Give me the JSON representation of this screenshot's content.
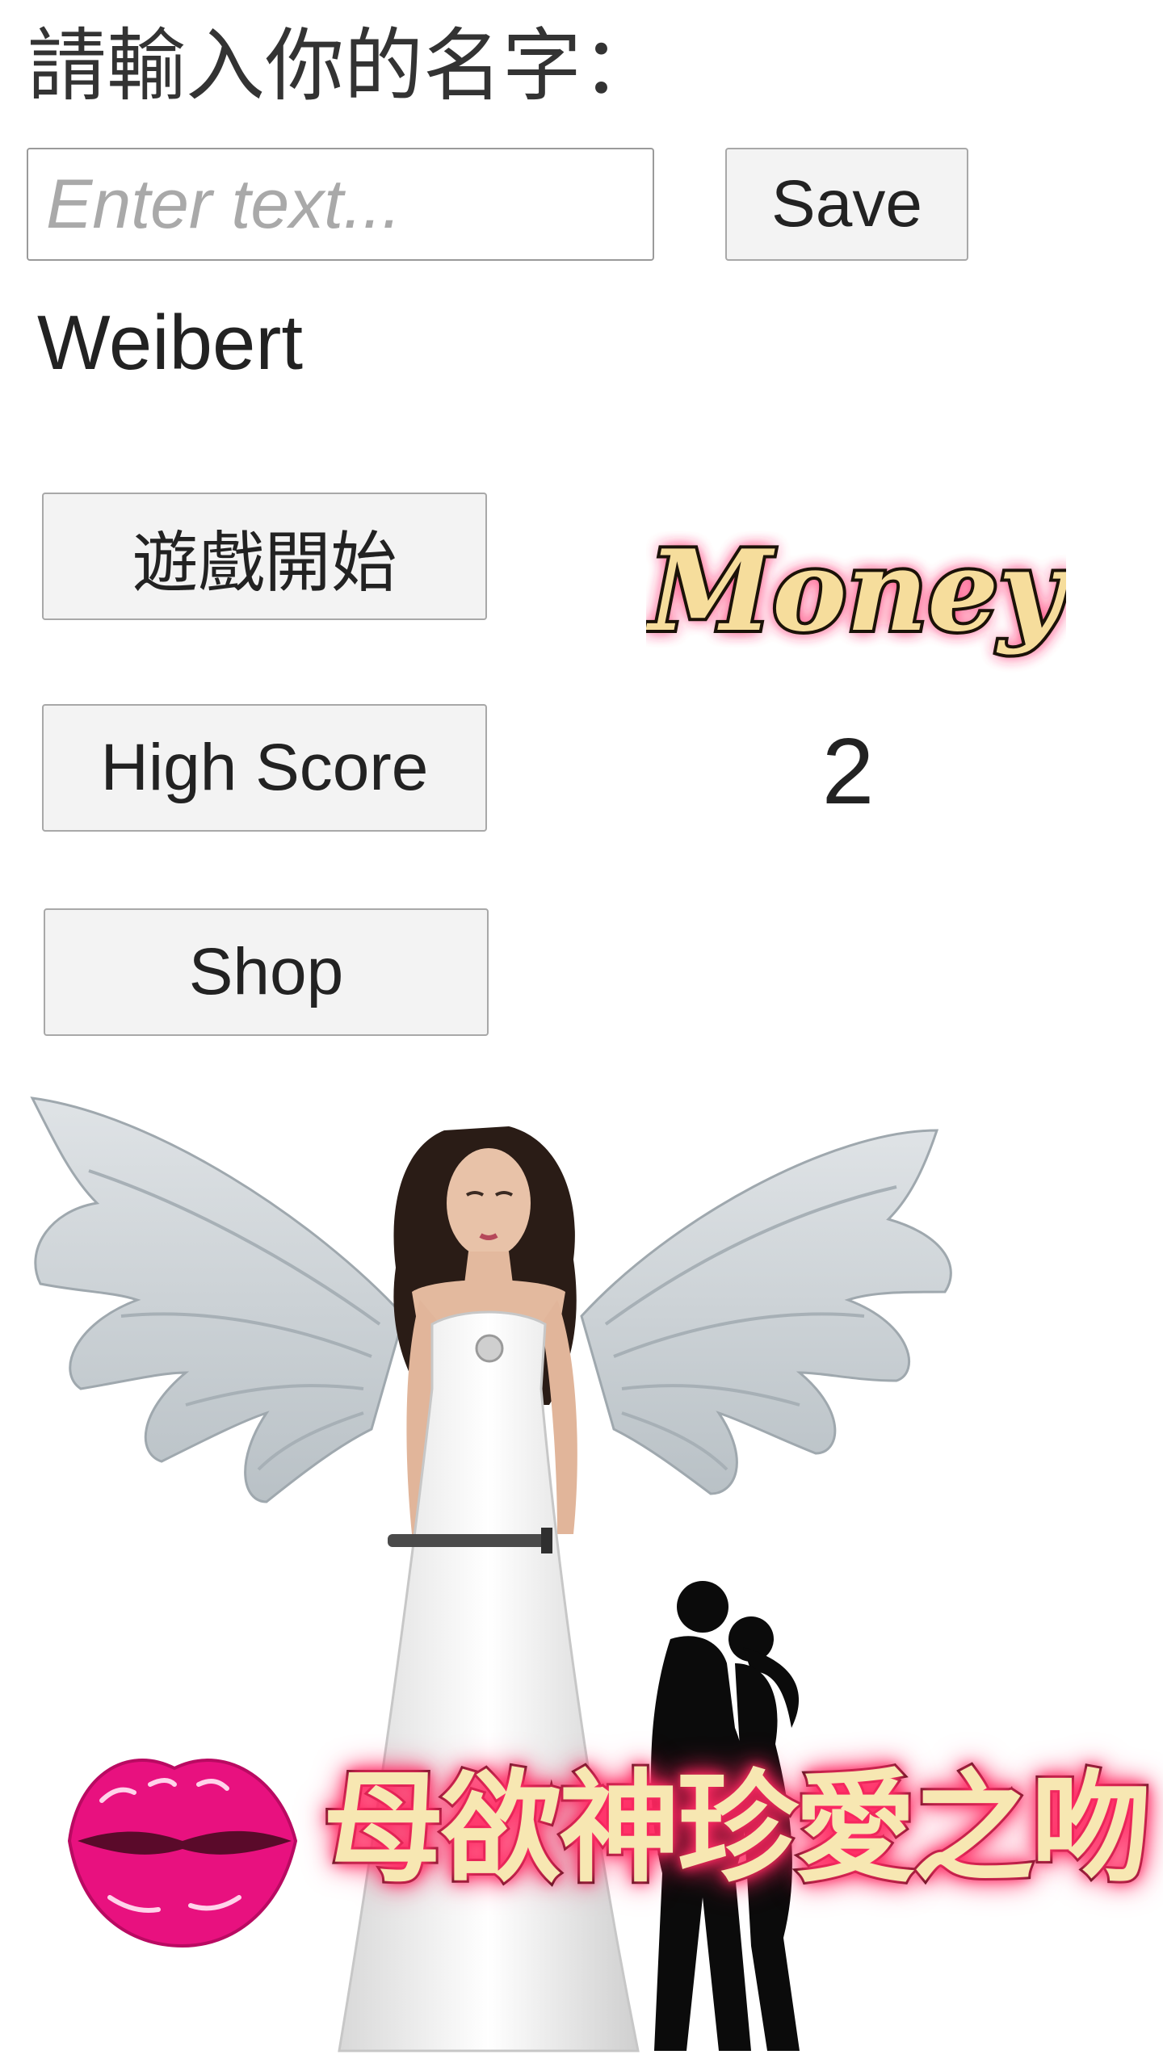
{
  "prompt": {
    "label": "請輸入你的名字："
  },
  "name_input": {
    "placeholder": "Enter text...",
    "value": ""
  },
  "save_button": {
    "label": "Save"
  },
  "saved_name": {
    "text": "Weibert"
  },
  "menu": {
    "start_label": "遊戲開始",
    "high_score_label": "High Score",
    "shop_label": "Shop"
  },
  "money": {
    "logo_text": "Money",
    "value": "2"
  },
  "artwork": {
    "subject": "angel-woman-with-wings",
    "couple": "kissing-couple-silhouette",
    "lips_icon": "pink-lips-icon"
  },
  "title_banner": {
    "text": "母欲神珍愛之吻"
  },
  "colors": {
    "accent_glow": "#ff2f6a",
    "banner_text": "#f7e7b2",
    "lips": "#e8117f",
    "button_bg": "#f3f3f3"
  }
}
